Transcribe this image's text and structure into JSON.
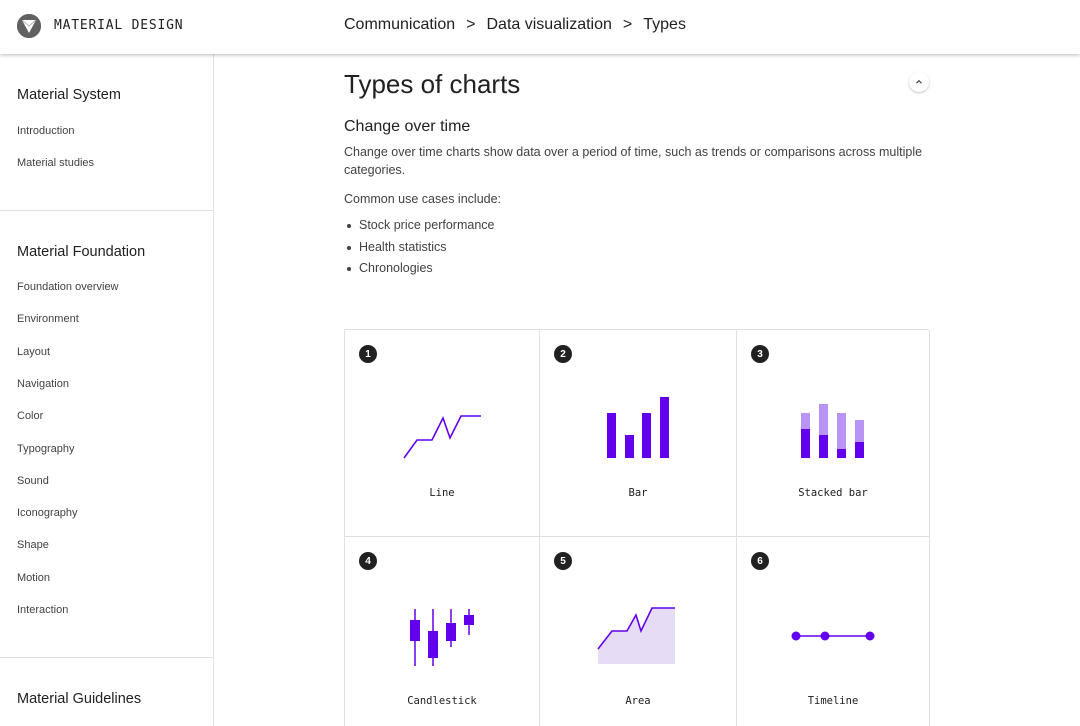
{
  "header": {
    "brand": "MATERIAL DESIGN",
    "breadcrumb": [
      "Communication",
      "Data visualization",
      "Types"
    ],
    "separator": ">"
  },
  "sidebar": {
    "sections": [
      {
        "title": "Material System",
        "items": [
          "Introduction",
          "Material studies"
        ]
      },
      {
        "title": "Material Foundation",
        "items": [
          "Foundation overview",
          "Environment",
          "Layout",
          "Navigation",
          "Color",
          "Typography",
          "Sound",
          "Iconography",
          "Shape",
          "Motion",
          "Interaction"
        ]
      },
      {
        "title": "Material Guidelines",
        "items": []
      }
    ]
  },
  "main": {
    "title": "Types of charts",
    "subtitle": "Change over time",
    "description": "Change over time charts show data over a period of time, such as trends or comparisons across multiple categories.",
    "use_cases_intro": "Common use cases include:",
    "use_cases": [
      "Stock price performance",
      "Health statistics",
      "Chronologies"
    ]
  },
  "chart_types": [
    {
      "number": "1",
      "label": "Line",
      "icon": "line-chart-icon"
    },
    {
      "number": "2",
      "label": "Bar",
      "icon": "bar-chart-icon"
    },
    {
      "number": "3",
      "label": "Stacked bar",
      "icon": "stacked-bar-chart-icon"
    },
    {
      "number": "4",
      "label": "Candlestick",
      "icon": "candlestick-chart-icon"
    },
    {
      "number": "5",
      "label": "Area",
      "icon": "area-chart-icon"
    },
    {
      "number": "6",
      "label": "Timeline",
      "icon": "timeline-chart-icon"
    }
  ],
  "colors": {
    "accent": "#6200ee",
    "accent_light": "#b794f6",
    "area_fill": "#e6dcf5",
    "badge": "#212121"
  }
}
